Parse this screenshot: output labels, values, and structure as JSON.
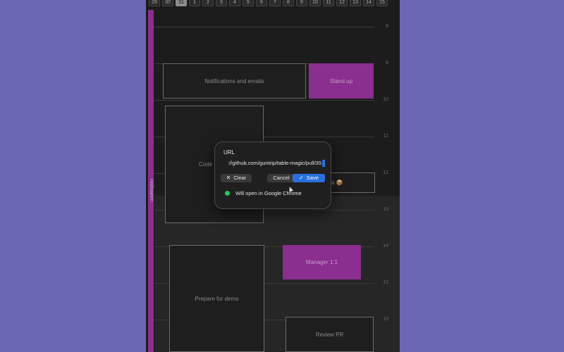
{
  "day_strip": [
    "29",
    "30",
    "31",
    "1",
    "2",
    "3",
    "4",
    "5",
    "6",
    "7",
    "8",
    "9",
    "10",
    "11",
    "12",
    "13",
    "14",
    "15"
  ],
  "active_day": "31",
  "allday_label": "Halloween",
  "hours": [
    "8",
    "9",
    "10",
    "11",
    "12",
    "13",
    "14",
    "15",
    "16"
  ],
  "events": {
    "notifications": "Notifications and emails",
    "standup": "Stand up",
    "code": "Code",
    "manager": "Manager 1:1",
    "prepare": "Prepare for demo",
    "review": "Review PR",
    "obscured_suffix": "a 📦"
  },
  "popover": {
    "label": "URL",
    "url_value": "://github.com/guntrip/table-magic/pull/35",
    "clear_label": "Clear",
    "cancel_label": "Cancel",
    "save_label": "Save",
    "status_text": "Will open in Google Chrome",
    "status_color": "#2fc45b",
    "accent_color": "#2b6fde"
  },
  "colors": {
    "background": "#6a68b4",
    "app_bg": "#1c1c1c",
    "event_purple": "#8a2e8f"
  }
}
